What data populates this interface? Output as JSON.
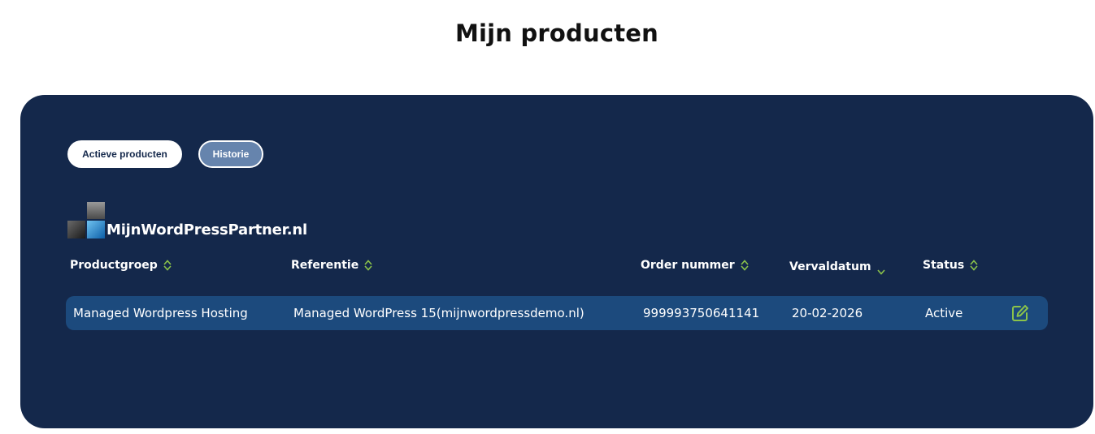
{
  "page": {
    "title": "Mijn producten"
  },
  "tabs": [
    {
      "label": "Actieve producten",
      "active": true
    },
    {
      "label": "Historie",
      "active": false
    }
  ],
  "brand": {
    "name": "MijnWordPressPartner.nl"
  },
  "table": {
    "columns": [
      "Productgroep",
      "Referentie",
      "Order nummer",
      "Vervaldatum",
      "Status"
    ],
    "sorted_column": "Vervaldatum",
    "rows": [
      {
        "productgroep": "Managed Wordpress Hosting",
        "referentie": "Managed WordPress 15(mijnwordpressdemo.nl)",
        "order_nummer": "999993750641141",
        "vervaldatum": "20-02-2026",
        "status": "Active",
        "action_icon": "edit-icon"
      }
    ]
  },
  "colors": {
    "panel_bg": "#14284b",
    "row_bg": "#1c4a7d",
    "accent_green": "#8bc34a",
    "history_tab_bg": "#6684ad"
  }
}
